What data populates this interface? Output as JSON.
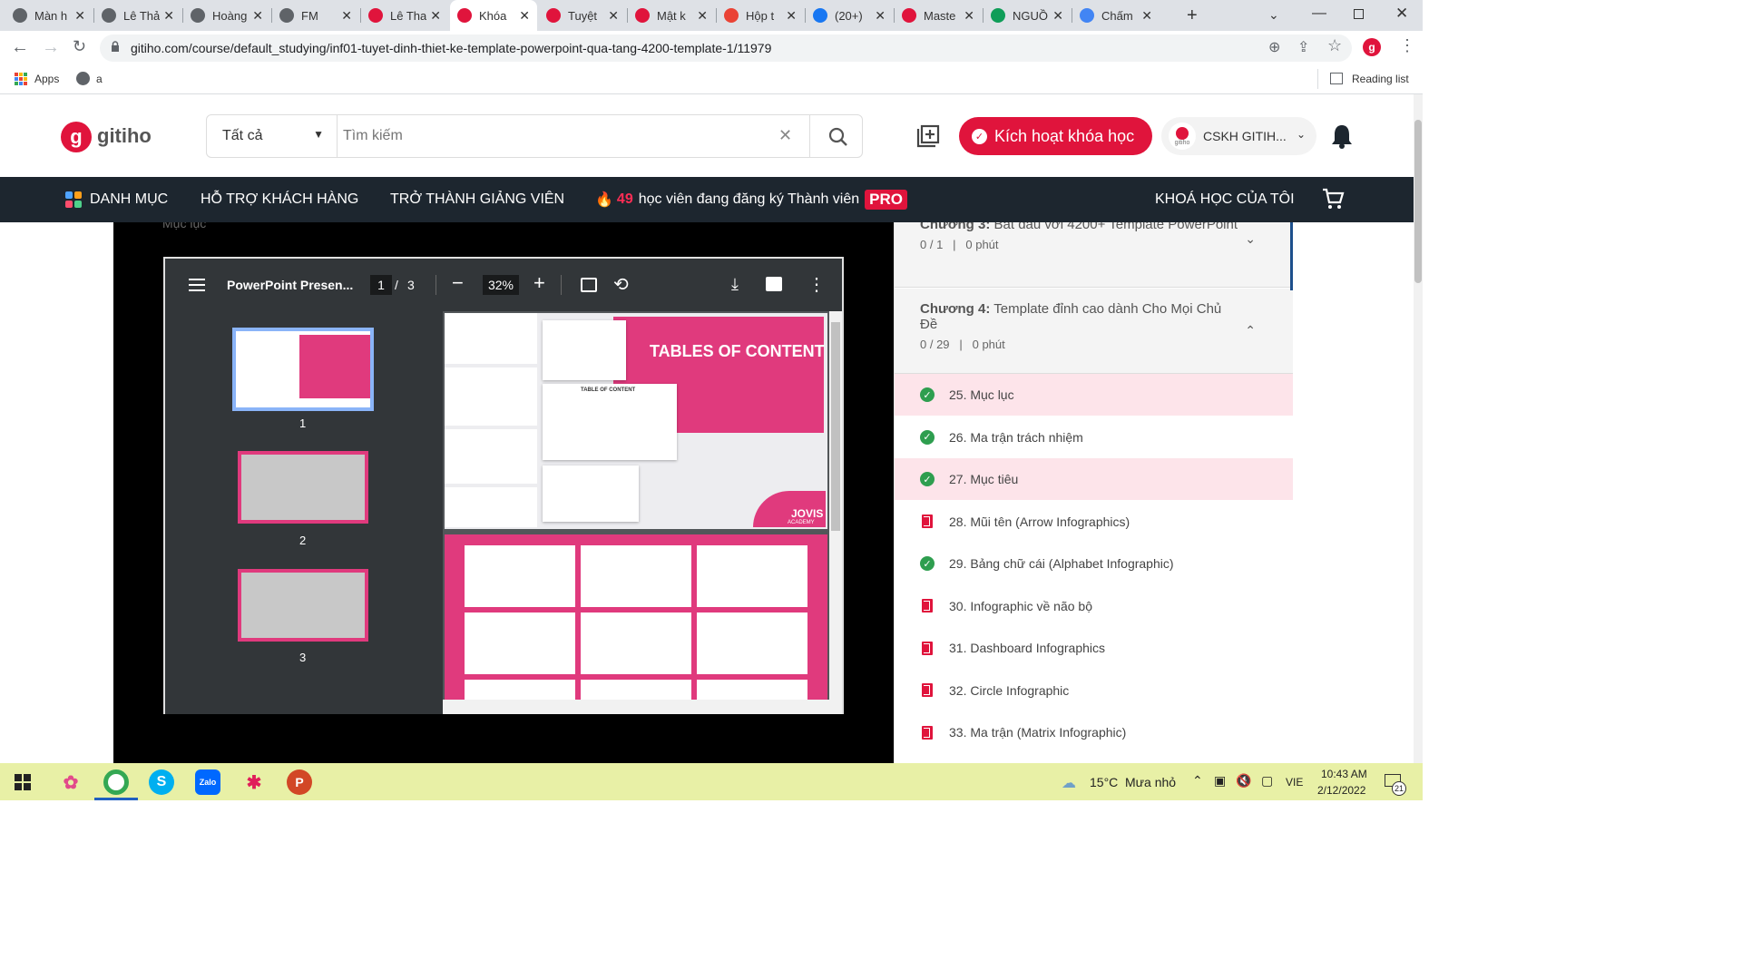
{
  "browser": {
    "tabs": [
      {
        "label": "Màn h",
        "color": "#5f6368"
      },
      {
        "label": "Lê Thả",
        "color": "#5f6368"
      },
      {
        "label": "Hoàng",
        "color": "#5f6368"
      },
      {
        "label": "FM",
        "color": "#5f6368"
      },
      {
        "label": "Lê Tha",
        "color": "#e0143c"
      },
      {
        "label": "Khóa",
        "color": "#e0143c"
      },
      {
        "label": "Tuyệt",
        "color": "#e0143c"
      },
      {
        "label": "Mật k",
        "color": "#e0143c"
      },
      {
        "label": "Hộp t",
        "color": "#ea4335"
      },
      {
        "label": "(20+)",
        "color": "#1877f2"
      },
      {
        "label": "Maste",
        "color": "#e0143c"
      },
      {
        "label": "NGUỒ",
        "color": "#0f9d58"
      },
      {
        "label": "Chấm",
        "color": "#4285f4"
      }
    ],
    "new_tab": "+",
    "url": "gitiho.com/course/default_studying/inf01-tuyet-dinh-thiet-ke-template-powerpoint-qua-tang-4200-template-1/11979",
    "bookmarks": {
      "apps": "Apps",
      "a": "a",
      "reading_list": "Reading list"
    }
  },
  "site": {
    "logo": "gitiho",
    "search_category": "Tất cả",
    "search_placeholder": "Tìm kiếm",
    "activate_button": "Kích hoạt khóa học",
    "account_label": "CSKH GITIH...",
    "avatar_text": "gitiho",
    "nav": {
      "categories": "DANH MỤC",
      "support": "HỖ TRỢ KHÁCH HÀNG",
      "become_teacher": "TRỞ THÀNH GIẢNG VIÊN",
      "promo_count": "49",
      "promo_text": "học viên đang đăng ký Thành viên",
      "promo_badge": "PRO",
      "my_courses": "KHOÁ HỌC CỦA TÔI"
    }
  },
  "player": {
    "heading": "Mục lục",
    "pdf": {
      "title": "PowerPoint Presen...",
      "page_current": "1",
      "page_sep": "/",
      "page_total": "3",
      "zoom": "32%",
      "thumbs": [
        "1",
        "2",
        "3"
      ],
      "slide_title": "TABLES OF CONTENT",
      "slide_brand": "JOVIS",
      "slide_brand_sub": "ACADEMY",
      "mini_title": "TABLE OF CONTENT"
    }
  },
  "sidebar": {
    "chapters": [
      {
        "prefix": "Chương 3:",
        "title": "Bắt đầu với 4200+ Template PowerPoint",
        "progress": "0 / 1",
        "sep": "|",
        "time": "0 phút",
        "expanded": false
      },
      {
        "prefix": "Chương 4:",
        "title": "Template đỉnh cao dành Cho Mọi Chủ Đề",
        "progress": "0 / 29",
        "sep": "|",
        "time": "0 phút",
        "expanded": true
      }
    ],
    "lessons": [
      {
        "label": "25. Mục lục",
        "status": "done",
        "highlight": true
      },
      {
        "label": "26. Ma trận trách nhiệm",
        "status": "done",
        "highlight": false
      },
      {
        "label": "27. Mục tiêu",
        "status": "done",
        "highlight": true
      },
      {
        "label": "28. Mũi tên (Arrow Infographics)",
        "status": "book",
        "highlight": false
      },
      {
        "label": "29. Bảng chữ cái (Alphabet Infographic)",
        "status": "done",
        "highlight": false
      },
      {
        "label": "30. Infographic về não bộ",
        "status": "book",
        "highlight": false
      },
      {
        "label": "31. Dashboard Infographics",
        "status": "book",
        "highlight": false
      },
      {
        "label": "32. Circle Infographic",
        "status": "book",
        "highlight": false
      },
      {
        "label": "33. Ma trận (Matrix Infographic)",
        "status": "book",
        "highlight": false
      }
    ]
  },
  "taskbar": {
    "weather": "15°C",
    "weather_desc": "Mưa nhỏ",
    "lang": "VIE",
    "time": "10:43 AM",
    "date": "2/12/2022",
    "notif_count": "21",
    "zalo": "Zalo"
  },
  "colors": {
    "brand": "#e0143c",
    "navbar": "#1d262f",
    "slide_pink": "#e03a7d"
  }
}
